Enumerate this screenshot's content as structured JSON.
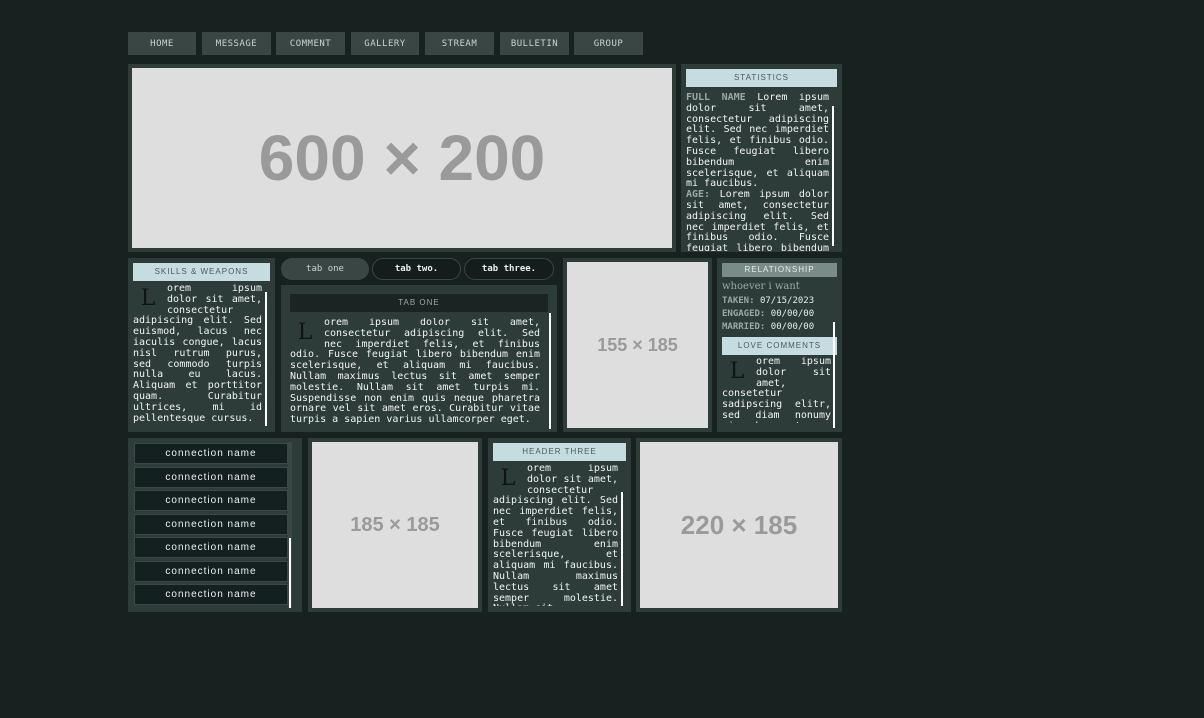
{
  "nav": [
    "HOME",
    "MESSAGE",
    "COMMENT",
    "GALLERY",
    "STREAM",
    "BULLETIN",
    "GROUP"
  ],
  "banner": {
    "placeholder": "600 × 200"
  },
  "statistics": {
    "title": "STATISTICS",
    "full_name_label": "FULL NAME",
    "full_name_value": "Lorem ipsum dolor sit amet, consectetur adipiscing elit. Sed nec imperdiet felis, et finibus odio. Fusce feugiat libero bibendum enim scelerisque, et aliquam mi faucibus.",
    "age_label": "AGE:",
    "age_value": "Lorem ipsum dolor sit amet, consectetur adipiscing elit. Sed nec imperdiet felis, et finibus odio. Fusce feugiat libero bibendum enim scelerisque."
  },
  "skills": {
    "title": "SKILLS & WEAPONS",
    "dropcap": "L",
    "text": "orem ipsum dolor sit amet, consectetur adipiscing elit. Sed euismod, lacus nec iaculis congue, lacus nisl rutrum purus, sed commodo turpis nulla eu lacus. Aliquam et porttitor quam. Curabitur ultrices, mi id pellentesque cursus."
  },
  "tabs": {
    "items": [
      "tab one",
      "tab two.",
      "tab three."
    ],
    "active_title": "TAB ONE",
    "dropcap": "L",
    "text": "orem ipsum dolor sit amet, consectetur adipiscing elit. Sed nec imperdiet felis, et finibus odio. Fusce feugiat libero bibendum enim scelerisque, et aliquam mi faucibus. Nullam maximus lectus sit amet semper molestie. Nullam sit amet turpis mi. Suspendisse non enim quis neque pharetra ornare vel sit amet eros. Curabitur vitae turpis a sapien varius ullamcorper eget."
  },
  "image_mid": {
    "placeholder": "155 × 185"
  },
  "relationship": {
    "title": "RELATIONSHIP",
    "wish": "whoever i want",
    "taken_label": "TAKEN:",
    "taken_value": "07/15/2023",
    "engaged_label": "ENGAGED:",
    "engaged_value": "00/00/00",
    "married_label": "MARRIED:",
    "married_value": "00/00/00",
    "love_title": "LOVE COMMENTS",
    "dropcap": "L",
    "love_text": "orem ipsum dolor sit amet, consetetur sadipscing elitr, sed diam nonumy eirmod tempor invidunt ut labore."
  },
  "connections": [
    "connection name",
    "connection name",
    "connection name",
    "connection name",
    "connection name",
    "connection name",
    "connection name"
  ],
  "image_bottom1": {
    "placeholder": "185 × 185"
  },
  "header_three": {
    "title": "HEADER THREE",
    "dropcap": "L",
    "text": "orem ipsum dolor sit amet, consectetur adipiscing elit. Sed nec imperdiet felis, et finibus odio. Fusce feugiat libero bibendum enim scelerisque, et aliquam mi faucibus. Nullam maximus lectus sit amet semper molestie. Nullam sit."
  },
  "image_bottom2": {
    "placeholder": "220 × 185"
  }
}
